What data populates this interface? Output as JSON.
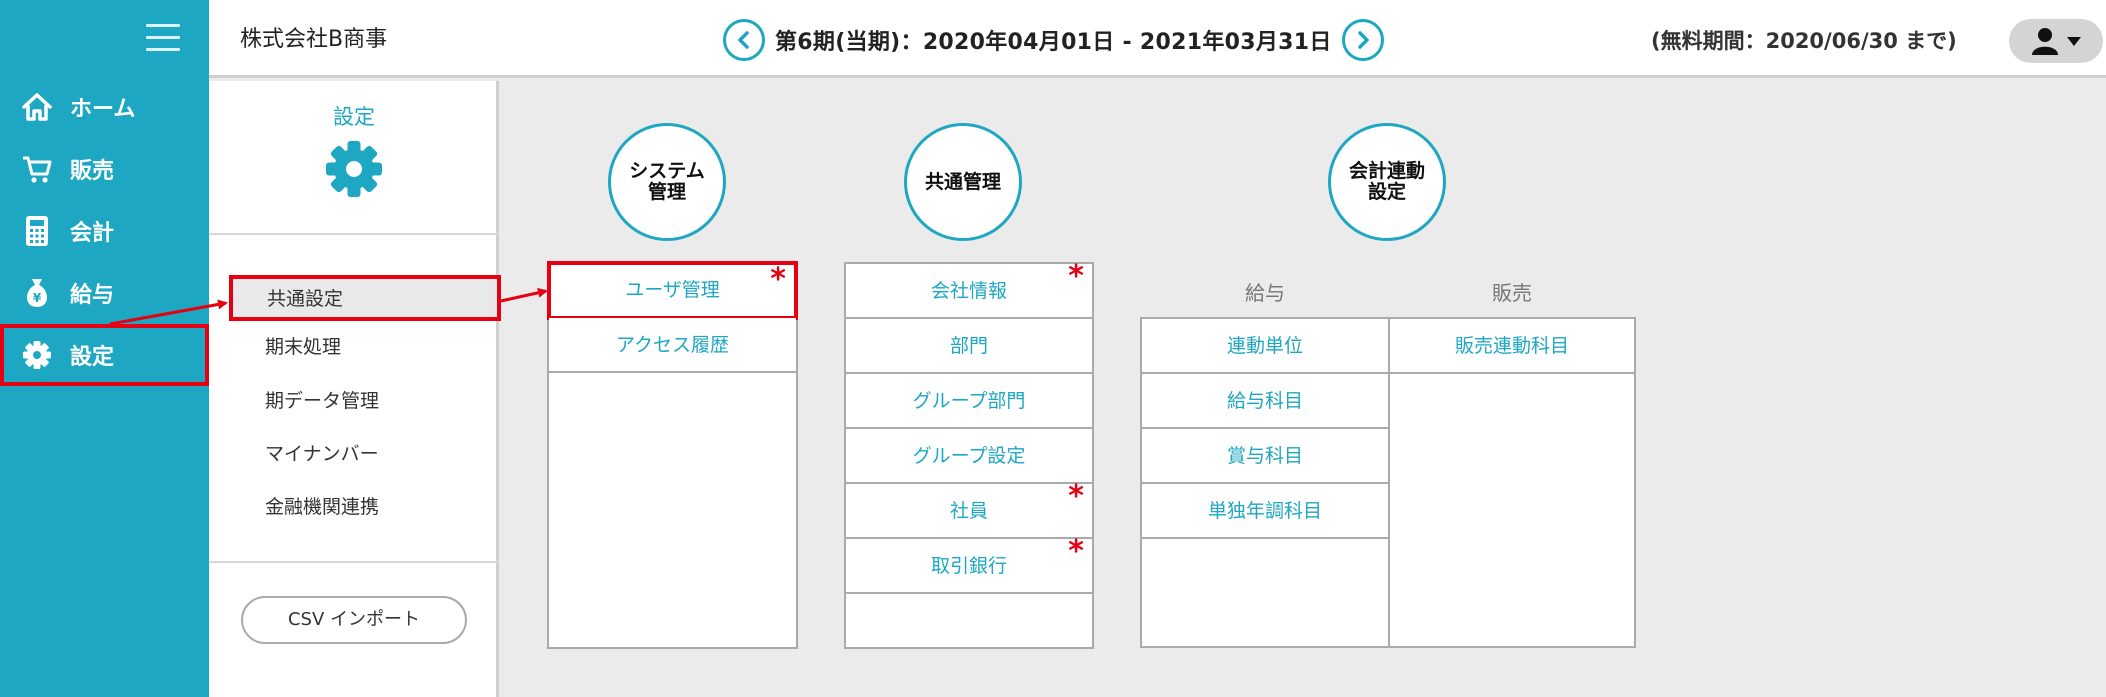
{
  "nav": {
    "items": [
      {
        "label": "ホーム",
        "icon": "home-icon"
      },
      {
        "label": "販売",
        "icon": "cart-icon"
      },
      {
        "label": "会計",
        "icon": "calculator-icon"
      },
      {
        "label": "給与",
        "icon": "money-bag-icon"
      },
      {
        "label": "設定",
        "icon": "gear-icon"
      }
    ],
    "active": "設定"
  },
  "header": {
    "company": "株式会社B商事",
    "period": "第6期(当期)：2020年04月01日 - 2021年03月31日",
    "trial": "(無料期間：2020/06/30 まで)"
  },
  "settings_panel": {
    "title": "設定",
    "items": [
      "共通設定",
      "期末処理",
      "期データ管理",
      "マイナンバー",
      "金融機関連携"
    ],
    "active": "共通設定",
    "csv_button": "CSV インポート"
  },
  "sections": {
    "system": {
      "title_line1": "システム",
      "title_line2": "管理",
      "items": [
        {
          "label": "ユーザ管理",
          "required": true
        },
        {
          "label": "アクセス履歴",
          "required": false
        }
      ]
    },
    "common": {
      "title": "共通管理",
      "items": [
        {
          "label": "会社情報",
          "required": true
        },
        {
          "label": "部門",
          "required": false
        },
        {
          "label": "グループ部門",
          "required": false
        },
        {
          "label": "グループ設定",
          "required": false
        },
        {
          "label": "社員",
          "required": true
        },
        {
          "label": "取引銀行",
          "required": true
        }
      ]
    },
    "accounting": {
      "title_line1": "会計連動",
      "title_line2": "設定",
      "payroll_label": "給与",
      "sales_label": "販売",
      "payroll_items": [
        "連動単位",
        "給与科目",
        "賞与科目",
        "単独年調科目"
      ],
      "sales_items": [
        "販売連動科目"
      ]
    }
  },
  "required_mark": "*",
  "colors": {
    "accent": "#1ea7c2",
    "highlight": "#e60012"
  }
}
